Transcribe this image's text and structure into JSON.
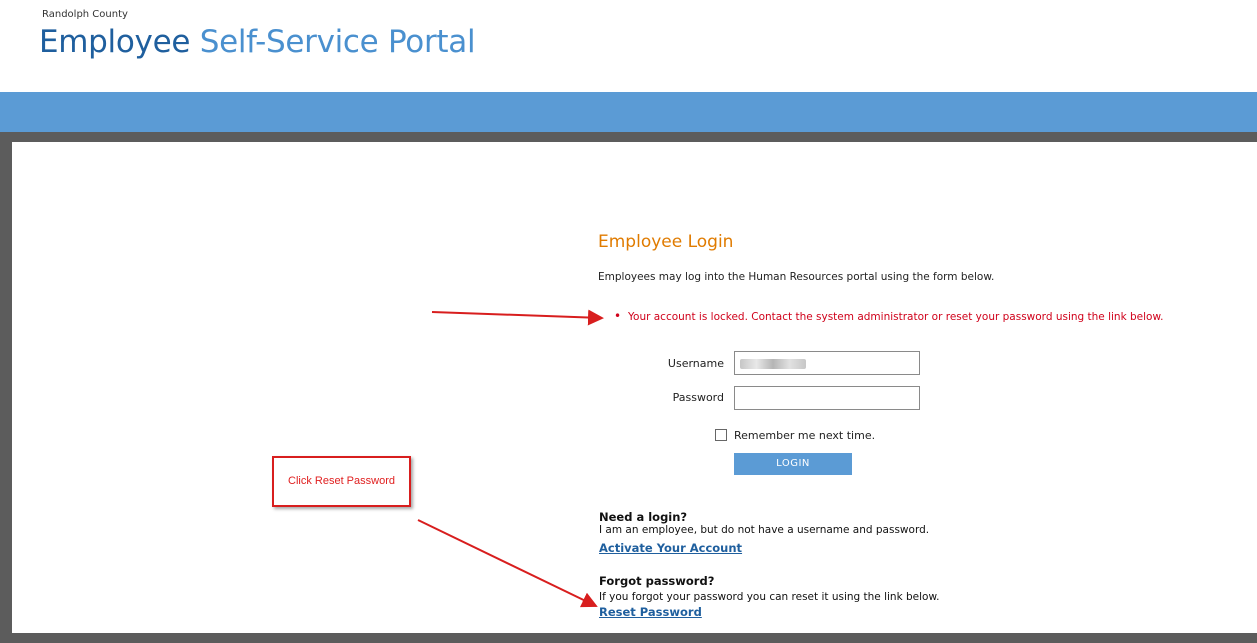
{
  "header": {
    "county": "Randolph County",
    "title_part1": "Employee",
    "title_part2": "Self-Service Portal"
  },
  "login": {
    "title": "Employee Login",
    "intro": "Employees may log into the Human Resources portal using the form below.",
    "error_message": "Your account is locked. Contact the system administrator or reset your password using the link below.",
    "username_label": "Username",
    "password_label": "Password",
    "remember_label": "Remember me next time.",
    "login_button": "LOGIN"
  },
  "need_login": {
    "title": "Need a login?",
    "text": "I am an employee, but do not have a username and password.",
    "link": "Activate Your Account"
  },
  "forgot_password": {
    "title": "Forgot password?",
    "text": "If you forgot your password you can reset it using the link below.",
    "link": "Reset Password"
  },
  "annotation": {
    "callout_text": "Click Reset Password",
    "color": "#d81e1e"
  },
  "colors": {
    "accent_bar": "#5b9bd5",
    "title_dark": "#1f5f9e",
    "title_light": "#4a90cf",
    "login_title": "#e07b00",
    "error": "#d0021b"
  }
}
